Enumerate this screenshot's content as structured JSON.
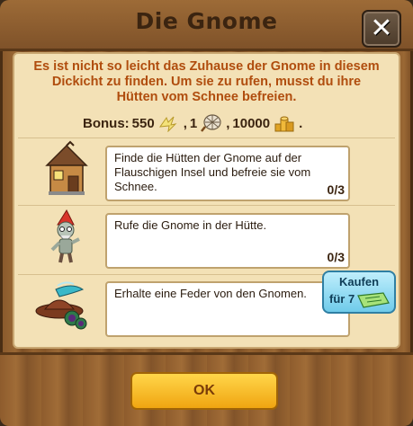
{
  "dialog": {
    "title": "Die Gnome",
    "close_icon": "close-x-icon"
  },
  "intro": {
    "line1": "Es ist nicht so leicht das Zuhause der Gnome in diesem",
    "line2": "Dickicht zu finden. Um sie zu rufen, musst du ihre",
    "line3": "Hütten vom Schnee befreien."
  },
  "bonus": {
    "label": "Bonus:",
    "energy_amount": "550",
    "energy_icon": "energy-lightning-icon",
    "sep1": ",",
    "net_amount": "1",
    "net_icon": "net-icon",
    "sep2": ",",
    "coins_amount": "10000",
    "coins_icon": "gold-coins-icon",
    "end": "."
  },
  "tasks": [
    {
      "icon": "gnome-hut-icon",
      "text": "Finde die Hütten der Gnome auf der Flauschigen Insel und befreie sie vom Schnee.",
      "progress": "0/3"
    },
    {
      "icon": "zombie-gnome-icon",
      "text": "Rufe die Gnome in der Hütte.",
      "progress": "0/3"
    },
    {
      "icon": "feather-hat-icon",
      "text": "Erhalte eine Feder von den Gnomen.",
      "progress": ""
    }
  ],
  "buy": {
    "label": "Kaufen",
    "prefix": "für",
    "price": "7",
    "currency_icon": "ticket-icon"
  },
  "ok_label": "OK",
  "colors": {
    "intro_text": "#b04d0e",
    "ok_button": "#f7b91f",
    "buy_button": "#8fd8f2",
    "parchment": "#f3e1b6"
  }
}
